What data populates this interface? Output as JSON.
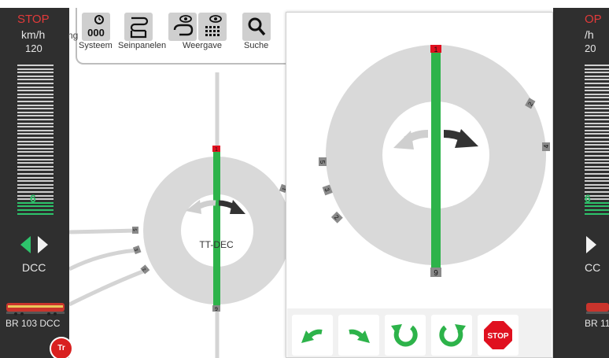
{
  "left_cab": {
    "stop_label": "STOP",
    "unit": "km/h",
    "max_speed": "120",
    "speed": "6",
    "protocol": "DCC",
    "loco_name": "BR 103 DCC"
  },
  "right_cab": {
    "stop_label": "OP",
    "unit": "/h",
    "max_speed": "20",
    "speed": "6",
    "protocol": "CC",
    "loco_name": "BR 11"
  },
  "toolbar": {
    "truncated_label": "ng",
    "systeem": "Systeem",
    "seinpanelen": "Seinpanelen",
    "weergave": "Weergave",
    "suche": "Suche"
  },
  "layout": {
    "turntable_name": "TT-DEC",
    "track_top": "1",
    "track_bottom": "9",
    "tracks_left": [
      "5",
      "3",
      "2"
    ],
    "track_right": "1"
  },
  "popup": {
    "track_top": "1",
    "track_bottom": "9",
    "tracks_right": [
      "2",
      "4"
    ],
    "tracks_left": [
      "5",
      "3",
      "2"
    ],
    "stop_button": "STOP"
  },
  "colors": {
    "green": "#2db34a",
    "red": "#e0101f",
    "ring": "#d9d9d9",
    "dark": "#2f2f2f"
  }
}
